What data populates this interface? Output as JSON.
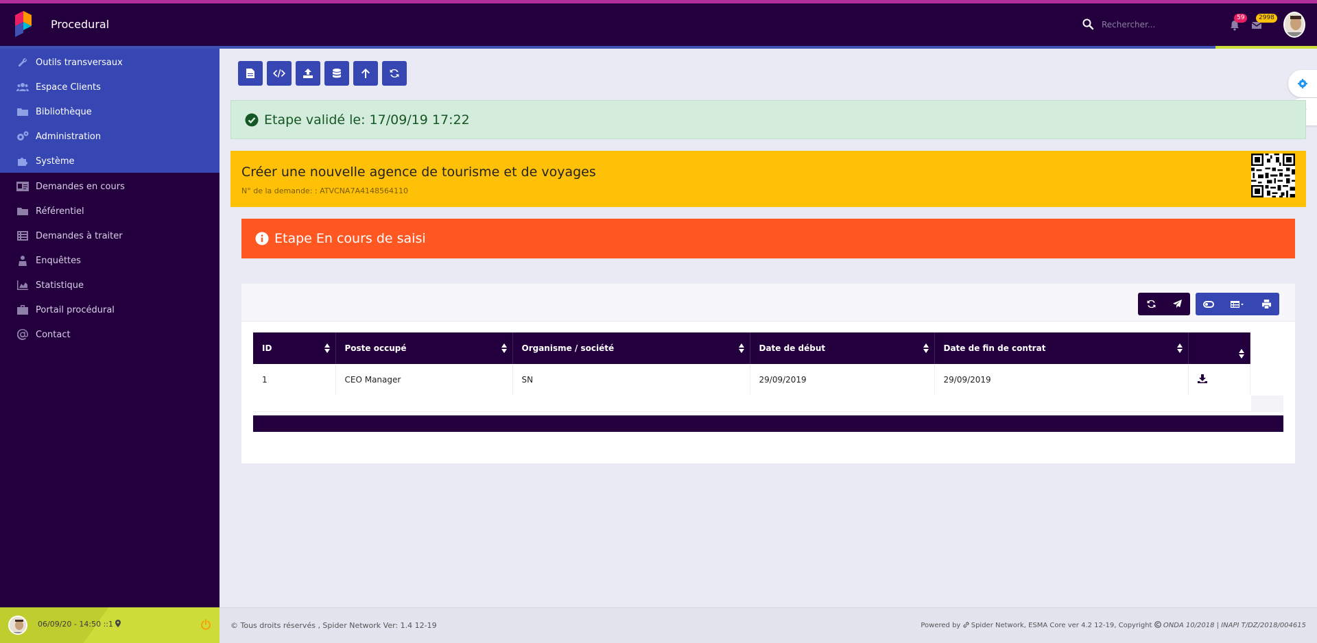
{
  "header": {
    "brand": "Procedural",
    "search_placeholder": "Rechercher...",
    "notifications_count": "59",
    "messages_count": "2998"
  },
  "sidebar": {
    "items": [
      {
        "label": "Outils transversaux",
        "icon": "wrench-icon"
      },
      {
        "label": "Espace Clients",
        "icon": "users-icon"
      },
      {
        "label": "Bibliothèque",
        "icon": "folder-icon"
      },
      {
        "label": "Administration",
        "icon": "gears-icon"
      },
      {
        "label": "Système",
        "icon": "puzzle-icon"
      },
      {
        "label": "Demandes en cours",
        "icon": "id-card-icon"
      },
      {
        "label": "Référentiel",
        "icon": "folder-icon"
      },
      {
        "label": "Demandes à traiter",
        "icon": "list-icon"
      },
      {
        "label": "Enquêttes",
        "icon": "survey-icon"
      },
      {
        "label": "Statistique",
        "icon": "area-chart-icon"
      },
      {
        "label": "Portail procédural",
        "icon": "briefcase-icon"
      },
      {
        "label": "Contact",
        "icon": "at-icon"
      }
    ],
    "footer_stamp": "06/09/20 - 14:50 ::1"
  },
  "alerts": {
    "validated": "Etape validé le: 17/09/19 17:22",
    "step_status": "Etape En cours de saisi"
  },
  "request": {
    "title": "Créer une nouvelle agence de tourisme et de voyages",
    "number": "N° de la demande: : ATVCNA7A4148564110"
  },
  "table": {
    "columns": [
      "ID",
      "Poste occupé",
      "Organisme / société",
      "Date de début",
      "Date de fin de contrat",
      ""
    ],
    "rows": [
      [
        "1",
        "CEO Manager",
        "SN",
        "29/09/2019",
        "29/09/2019"
      ]
    ]
  },
  "footer": {
    "left": "© Tous droits réservés , Spider Network Ver: 1.4 12-19",
    "right_prefix": "Powered by",
    "right_brand": "Spider Network, ESMA Core ver 4.2 12-19, Copyright",
    "right_italic": "ONDA 10/2018 | INAPI T/DZ/2018/004615"
  },
  "colors": {
    "topbar": "#23003d",
    "primary": "#3646b3",
    "accent_yellow": "#ffc107",
    "step_orange": "#ff5722",
    "lime": "#cddc39",
    "success_bg": "#d4ecdc"
  }
}
